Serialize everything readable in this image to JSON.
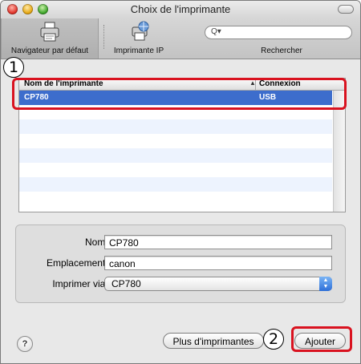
{
  "window": {
    "title": "Choix de l'imprimante"
  },
  "toolbar": {
    "default_browser_label": "Navigateur par défaut",
    "ip_printer_label": "Imprimante IP",
    "search_label": "Rechercher",
    "search_placeholder": "Q▾"
  },
  "printer_list": {
    "columns": [
      "Nom de l'imprimante",
      "Connexion"
    ],
    "rows": [
      {
        "name": "CP780",
        "connection": "USB",
        "selected": true
      }
    ]
  },
  "info": {
    "name_label": "Nom :",
    "name_value": "CP780",
    "location_label": "Emplacement :",
    "location_value": "canon",
    "print_using_label": "Imprimer via :",
    "print_using_value": "CP780"
  },
  "buttons": {
    "help": "?",
    "more_printers": "Plus d'imprimantes",
    "add": "Ajouter"
  },
  "annotations": {
    "step1": "1",
    "step2": "2"
  },
  "colors": {
    "selection": "#3d6dcc",
    "annotation": "#d9121f"
  }
}
